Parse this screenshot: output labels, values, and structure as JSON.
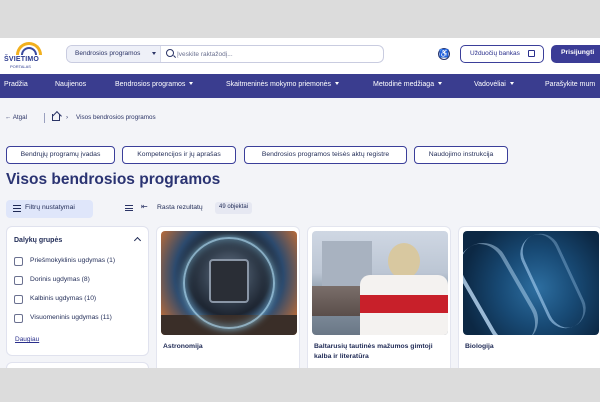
{
  "header": {
    "logo_line1": "ŠVIETIMO",
    "logo_line2": "PORTALAS",
    "search_category": "Bendrosios programos",
    "search_placeholder": "Įveskite raktažodį...",
    "bank_button": "Užduočių bankas",
    "login_button": "Prisijungti"
  },
  "nav": {
    "items": [
      {
        "label": "Pradžia"
      },
      {
        "label": "Naujienos"
      },
      {
        "label": "Bendrosios programos"
      },
      {
        "label": "Skaitmeninės mokymo priemonės"
      },
      {
        "label": "Metodinė medžiaga"
      },
      {
        "label": "Vadovėliai"
      },
      {
        "label": "Parašykite mum"
      }
    ]
  },
  "breadcrumb": {
    "back": "Atgal",
    "current": "Visos bendrosios programos"
  },
  "chips": [
    {
      "label": "Bendrųjų programų įvadas"
    },
    {
      "label": "Kompetencijos ir jų aprašas"
    },
    {
      "label": "Bendrosios programos teisės aktų registre"
    },
    {
      "label": "Naudojimo instrukcija"
    }
  ],
  "page_title": "Visos bendrosios programos",
  "toolbar": {
    "filters_button": "Filtrų nustatymai",
    "results_label": "Rasta rezultatų",
    "results_count": "49 objektai"
  },
  "sidebar": {
    "group_title": "Dalykų grupės",
    "options": [
      {
        "label": "Priešmokyklinis ugdymas (1)"
      },
      {
        "label": "Dorinis ugdymas (8)"
      },
      {
        "label": "Kalbinis ugdymas (10)"
      },
      {
        "label": "Visuomeninis ugdymas (11)"
      }
    ],
    "more_link": "Daugiau"
  },
  "cards": [
    {
      "title": "Astronomija",
      "image": "astronomy-photo"
    },
    {
      "title": "Baltarusių tautinės mažumos gimtoji kalba ir literatūra",
      "image": "flag-photo"
    },
    {
      "title": "Biologija",
      "image": "dna-photo"
    }
  ],
  "colors": {
    "nav_bg": "#3a3d8f",
    "accent": "#3b3c96",
    "logo_yellow": "#f2b01e",
    "page_bg": "#f3f4f8"
  }
}
